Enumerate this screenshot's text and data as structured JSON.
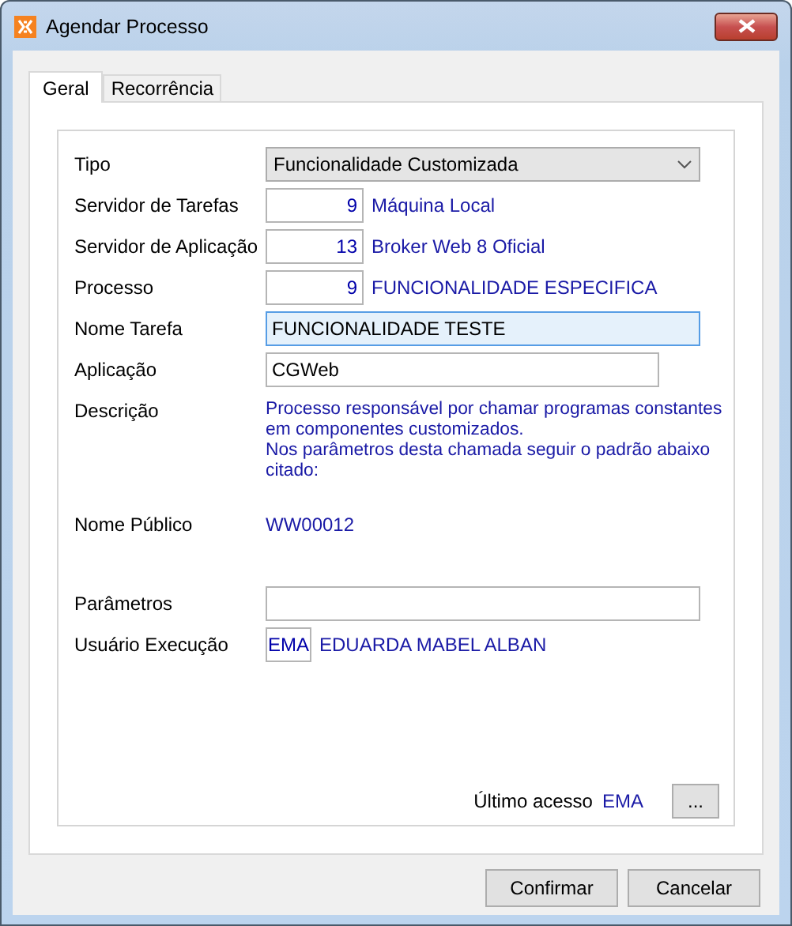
{
  "window": {
    "title": "Agendar Processo"
  },
  "tabs": [
    {
      "label": "Geral",
      "selected": true
    },
    {
      "label": "Recorrência",
      "selected": false
    }
  ],
  "fields": [
    {
      "kind": "select",
      "label": "Tipo",
      "value": "Funcionalidade Customizada"
    },
    {
      "kind": "code",
      "label": "Servidor de Tarefas",
      "code": "9",
      "description": "Máquina Local"
    },
    {
      "kind": "code",
      "label": "Servidor de Aplicação",
      "code": "13",
      "description": "Broker Web 8 Oficial"
    },
    {
      "kind": "code",
      "label": "Processo",
      "code": "9",
      "description": "FUNCIONALIDADE ESPECIFICA"
    },
    {
      "kind": "input",
      "label": "Nome Tarefa",
      "value": "FUNCIONALIDADE TESTE",
      "focused": true
    },
    {
      "kind": "input",
      "label": "Aplicação",
      "value": "CGWeb",
      "focused": false
    },
    {
      "kind": "text",
      "label": "Descrição",
      "value": "Processo responsável por chamar programas constantes\nem componentes customizados.\nNos parâmetros desta chamada seguir o padrão abaixo\ncitado:"
    },
    {
      "kind": "text",
      "label": "Nome Público",
      "value": "WW00012"
    },
    {
      "kind": "input",
      "label": "Parâmetros",
      "focused": false
    },
    {
      "kind": "user",
      "label": "Usuário Execução",
      "code": "EMA",
      "description": "EDUARDA MABEL ALBAN"
    }
  ],
  "last_access": {
    "label": "Último acesso",
    "value": "EMA"
  },
  "more_button": "...",
  "buttons": [
    "Confirmar",
    "Cancelar"
  ]
}
